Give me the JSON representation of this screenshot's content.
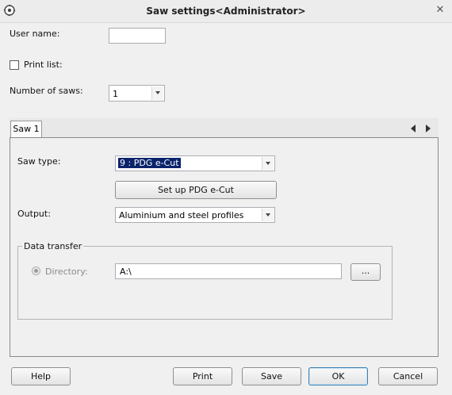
{
  "window": {
    "title": "Saw settings<Administrator>"
  },
  "form": {
    "user_name_label": "User name:",
    "user_name_value": "",
    "print_list_label": "Print list:",
    "print_list_checked": false,
    "number_of_saws_label": "Number of saws:",
    "number_of_saws_value": "1"
  },
  "tabs": [
    {
      "label": "Saw 1",
      "selected": true
    }
  ],
  "saw": {
    "saw_type_label": "Saw type:",
    "saw_type_value": "9 :  PDG e-Cut",
    "setup_button": "Set up PDG e-Cut",
    "output_label": "Output:",
    "output_value": "Aluminium and steel profiles"
  },
  "data_transfer": {
    "group_title": "Data transfer",
    "directory_label": "Directory:",
    "directory_value": "A:\\",
    "browse_button": "..."
  },
  "buttons": {
    "help": "Help",
    "print": "Print",
    "save": "Save",
    "ok": "OK",
    "cancel": "Cancel"
  },
  "icons": {
    "app": "saw-settings-icon",
    "close": "close-icon"
  },
  "colors": {
    "selection_bg": "#0b246b",
    "selection_fg": "#ffffff"
  }
}
